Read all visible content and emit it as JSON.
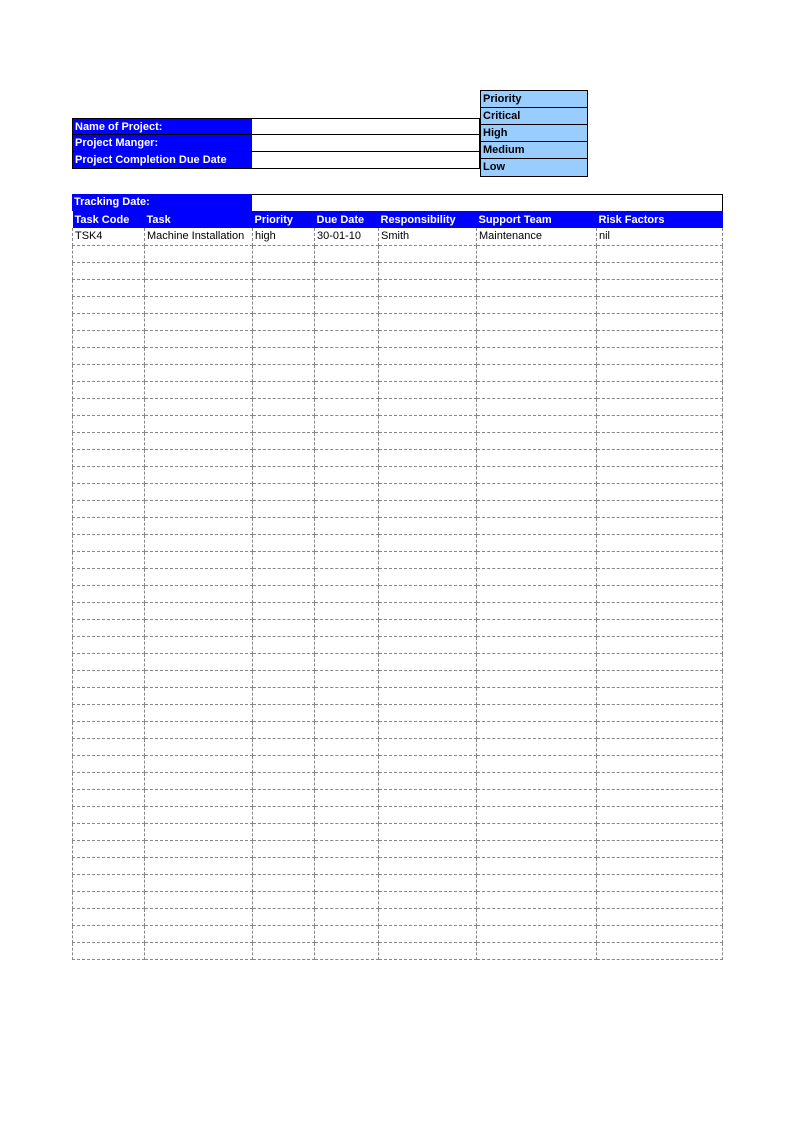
{
  "meta": {
    "name_label": "Name of Project:",
    "name_value": "",
    "manager_label": "Project Manger:",
    "manager_value": "",
    "completion_label": "Project Completion Due Date",
    "completion_value": ""
  },
  "priority_legend": {
    "header": "Priority",
    "levels": [
      "Critical",
      "High",
      "Medium",
      "Low"
    ]
  },
  "tracking": {
    "label": "Tracking Date:",
    "value": ""
  },
  "columns": {
    "code": "Task Code",
    "task": "Task",
    "priority": "Priority",
    "due": "Due Date",
    "responsibility": "Responsibility",
    "support": "Support Team",
    "risk": "Risk Factors"
  },
  "rows": [
    {
      "code": "TSK4",
      "task": "Machine Installation",
      "priority": "high",
      "due": "30-01-10",
      "responsibility": "Smith",
      "support": "Maintenance",
      "risk": "nil"
    }
  ],
  "empty_rows": 42
}
